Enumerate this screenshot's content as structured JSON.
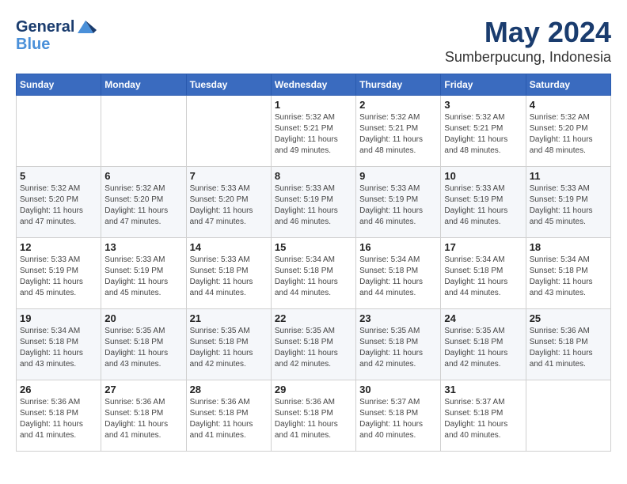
{
  "header": {
    "logo_general": "General",
    "logo_blue": "Blue",
    "month_title": "May 2024",
    "location": "Sumberpucung, Indonesia"
  },
  "days_of_week": [
    "Sunday",
    "Monday",
    "Tuesday",
    "Wednesday",
    "Thursday",
    "Friday",
    "Saturday"
  ],
  "weeks": [
    [
      {
        "day": "",
        "info": ""
      },
      {
        "day": "",
        "info": ""
      },
      {
        "day": "",
        "info": ""
      },
      {
        "day": "1",
        "info": "Sunrise: 5:32 AM\nSunset: 5:21 PM\nDaylight: 11 hours\nand 49 minutes."
      },
      {
        "day": "2",
        "info": "Sunrise: 5:32 AM\nSunset: 5:21 PM\nDaylight: 11 hours\nand 48 minutes."
      },
      {
        "day": "3",
        "info": "Sunrise: 5:32 AM\nSunset: 5:21 PM\nDaylight: 11 hours\nand 48 minutes."
      },
      {
        "day": "4",
        "info": "Sunrise: 5:32 AM\nSunset: 5:20 PM\nDaylight: 11 hours\nand 48 minutes."
      }
    ],
    [
      {
        "day": "5",
        "info": "Sunrise: 5:32 AM\nSunset: 5:20 PM\nDaylight: 11 hours\nand 47 minutes."
      },
      {
        "day": "6",
        "info": "Sunrise: 5:32 AM\nSunset: 5:20 PM\nDaylight: 11 hours\nand 47 minutes."
      },
      {
        "day": "7",
        "info": "Sunrise: 5:33 AM\nSunset: 5:20 PM\nDaylight: 11 hours\nand 47 minutes."
      },
      {
        "day": "8",
        "info": "Sunrise: 5:33 AM\nSunset: 5:19 PM\nDaylight: 11 hours\nand 46 minutes."
      },
      {
        "day": "9",
        "info": "Sunrise: 5:33 AM\nSunset: 5:19 PM\nDaylight: 11 hours\nand 46 minutes."
      },
      {
        "day": "10",
        "info": "Sunrise: 5:33 AM\nSunset: 5:19 PM\nDaylight: 11 hours\nand 46 minutes."
      },
      {
        "day": "11",
        "info": "Sunrise: 5:33 AM\nSunset: 5:19 PM\nDaylight: 11 hours\nand 45 minutes."
      }
    ],
    [
      {
        "day": "12",
        "info": "Sunrise: 5:33 AM\nSunset: 5:19 PM\nDaylight: 11 hours\nand 45 minutes."
      },
      {
        "day": "13",
        "info": "Sunrise: 5:33 AM\nSunset: 5:19 PM\nDaylight: 11 hours\nand 45 minutes."
      },
      {
        "day": "14",
        "info": "Sunrise: 5:33 AM\nSunset: 5:18 PM\nDaylight: 11 hours\nand 44 minutes."
      },
      {
        "day": "15",
        "info": "Sunrise: 5:34 AM\nSunset: 5:18 PM\nDaylight: 11 hours\nand 44 minutes."
      },
      {
        "day": "16",
        "info": "Sunrise: 5:34 AM\nSunset: 5:18 PM\nDaylight: 11 hours\nand 44 minutes."
      },
      {
        "day": "17",
        "info": "Sunrise: 5:34 AM\nSunset: 5:18 PM\nDaylight: 11 hours\nand 44 minutes."
      },
      {
        "day": "18",
        "info": "Sunrise: 5:34 AM\nSunset: 5:18 PM\nDaylight: 11 hours\nand 43 minutes."
      }
    ],
    [
      {
        "day": "19",
        "info": "Sunrise: 5:34 AM\nSunset: 5:18 PM\nDaylight: 11 hours\nand 43 minutes."
      },
      {
        "day": "20",
        "info": "Sunrise: 5:35 AM\nSunset: 5:18 PM\nDaylight: 11 hours\nand 43 minutes."
      },
      {
        "day": "21",
        "info": "Sunrise: 5:35 AM\nSunset: 5:18 PM\nDaylight: 11 hours\nand 42 minutes."
      },
      {
        "day": "22",
        "info": "Sunrise: 5:35 AM\nSunset: 5:18 PM\nDaylight: 11 hours\nand 42 minutes."
      },
      {
        "day": "23",
        "info": "Sunrise: 5:35 AM\nSunset: 5:18 PM\nDaylight: 11 hours\nand 42 minutes."
      },
      {
        "day": "24",
        "info": "Sunrise: 5:35 AM\nSunset: 5:18 PM\nDaylight: 11 hours\nand 42 minutes."
      },
      {
        "day": "25",
        "info": "Sunrise: 5:36 AM\nSunset: 5:18 PM\nDaylight: 11 hours\nand 41 minutes."
      }
    ],
    [
      {
        "day": "26",
        "info": "Sunrise: 5:36 AM\nSunset: 5:18 PM\nDaylight: 11 hours\nand 41 minutes."
      },
      {
        "day": "27",
        "info": "Sunrise: 5:36 AM\nSunset: 5:18 PM\nDaylight: 11 hours\nand 41 minutes."
      },
      {
        "day": "28",
        "info": "Sunrise: 5:36 AM\nSunset: 5:18 PM\nDaylight: 11 hours\nand 41 minutes."
      },
      {
        "day": "29",
        "info": "Sunrise: 5:36 AM\nSunset: 5:18 PM\nDaylight: 11 hours\nand 41 minutes."
      },
      {
        "day": "30",
        "info": "Sunrise: 5:37 AM\nSunset: 5:18 PM\nDaylight: 11 hours\nand 40 minutes."
      },
      {
        "day": "31",
        "info": "Sunrise: 5:37 AM\nSunset: 5:18 PM\nDaylight: 11 hours\nand 40 minutes."
      },
      {
        "day": "",
        "info": ""
      }
    ]
  ]
}
